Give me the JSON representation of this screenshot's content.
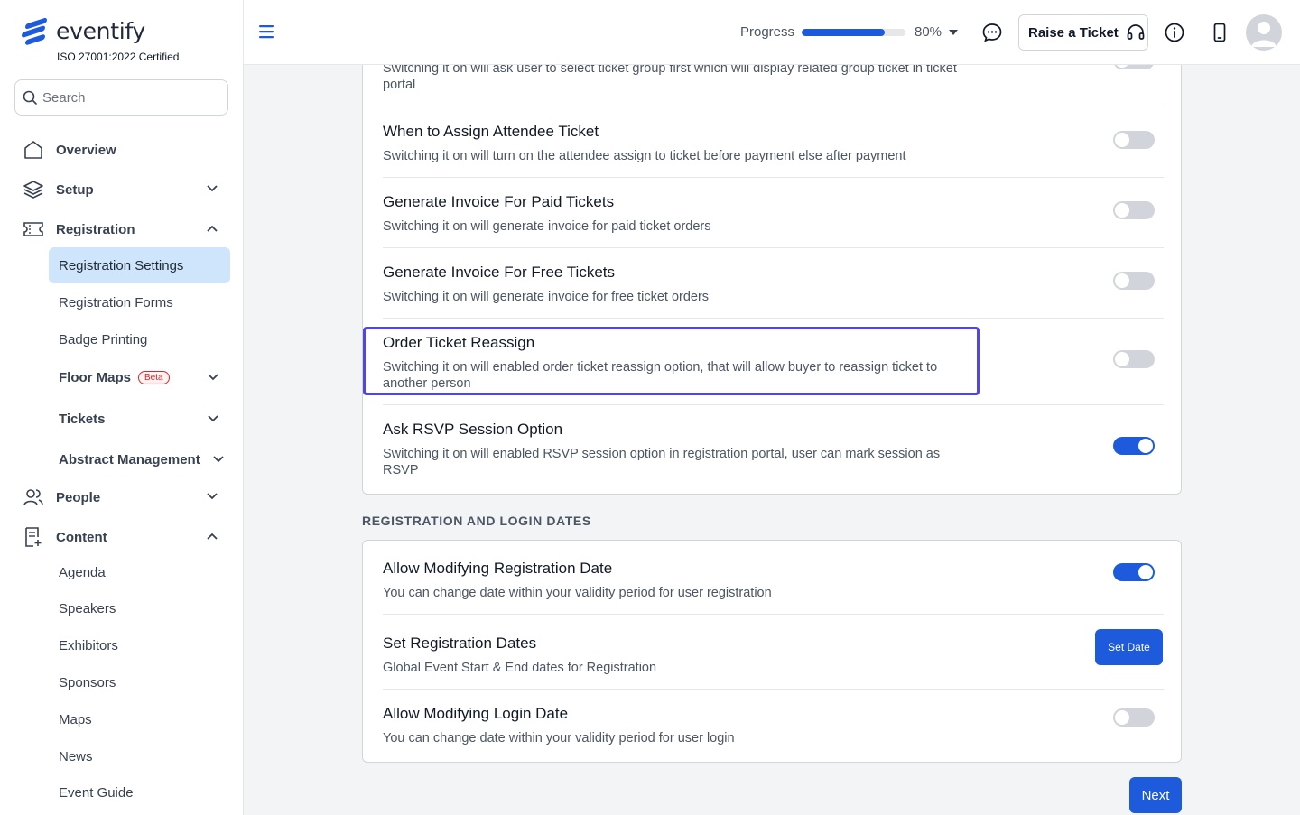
{
  "brand": {
    "name": "eventify",
    "certification": "ISO 27001:2022 Certified"
  },
  "search": {
    "placeholder": "Search"
  },
  "sidebar": {
    "items": [
      {
        "label": "Overview"
      },
      {
        "label": "Setup"
      },
      {
        "label": "Registration"
      },
      {
        "label": "People"
      },
      {
        "label": "Content"
      }
    ],
    "registration_sub": [
      {
        "label": "Registration Settings"
      },
      {
        "label": "Registration Forms"
      },
      {
        "label": "Badge Printing"
      },
      {
        "label": "Floor Maps",
        "badge": "Beta"
      },
      {
        "label": "Tickets"
      },
      {
        "label": "Abstract Management"
      }
    ],
    "content_sub": [
      {
        "label": "Agenda"
      },
      {
        "label": "Speakers"
      },
      {
        "label": "Exhibitors"
      },
      {
        "label": "Sponsors"
      },
      {
        "label": "Maps"
      },
      {
        "label": "News"
      },
      {
        "label": "Event Guide"
      }
    ]
  },
  "header": {
    "progress_label": "Progress",
    "progress_value": 0.8,
    "progress_text": "80%",
    "raise_ticket": "Raise a Ticket"
  },
  "settings_card": {
    "partial_row_desc": "Switching it on will ask user to select ticket group first which will display related group ticket in ticket portal",
    "rows": [
      {
        "title": "When to Assign Attendee Ticket",
        "desc": "Switching it on will turn on the attendee assign to ticket before payment else after payment",
        "enabled": false
      },
      {
        "title": "Generate Invoice For Paid Tickets",
        "desc": "Switching it on will generate invoice for paid ticket orders",
        "enabled": false
      },
      {
        "title": "Generate Invoice For Free Tickets",
        "desc": "Switching it on will generate invoice for free ticket orders",
        "enabled": false
      },
      {
        "title": "Order Ticket Reassign",
        "desc": "Switching it on will enabled order ticket reassign option, that will allow buyer to reassign ticket to another person",
        "enabled": false
      },
      {
        "title": "Ask RSVP Session Option",
        "desc": "Switching it on will enabled RSVP session option in registration portal, user can mark session as RSVP",
        "enabled": true
      }
    ]
  },
  "dates_section": {
    "title": "REGISTRATION AND LOGIN DATES",
    "rows": [
      {
        "title": "Allow Modifying Registration Date",
        "desc": "You can change date within your validity period for user registration",
        "enabled": true
      },
      {
        "title": "Set Registration Dates",
        "desc": "Global Event Start & End dates for Registration",
        "button": "Set Date"
      },
      {
        "title": "Allow Modifying Login Date",
        "desc": "You can change date within your validity period for user login",
        "enabled": false
      }
    ]
  },
  "footer": {
    "next_label": "Next"
  },
  "colors": {
    "accent": "#1d5bdc",
    "active_nav": "#cfe5fb",
    "highlight": "#4f46e5"
  }
}
